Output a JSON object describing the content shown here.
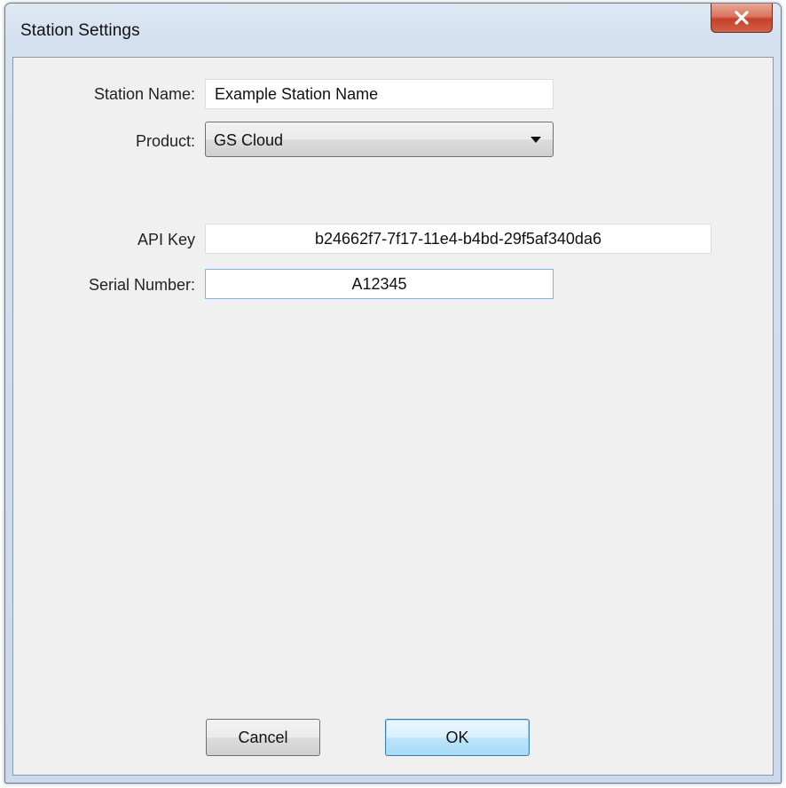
{
  "window": {
    "title": "Station Settings"
  },
  "fields": {
    "station_name": {
      "label": "Station Name:",
      "value": "Example Station Name"
    },
    "product": {
      "label": "Product:",
      "selected": "GS Cloud"
    },
    "api_key": {
      "label": "API Key",
      "value": "b24662f7-7f17-11e4-b4bd-29f5af340da6"
    },
    "serial_number": {
      "label": "Serial Number:",
      "value": "A12345"
    }
  },
  "buttons": {
    "cancel_label": "Cancel",
    "ok_label": "OK"
  },
  "colors": {
    "close_button": "#c4402a",
    "focus_border": "#7eb4ea",
    "default_button": "#3c7fb1"
  },
  "icons": {
    "close": "close-icon",
    "dropdown": "chevron-down-icon"
  }
}
